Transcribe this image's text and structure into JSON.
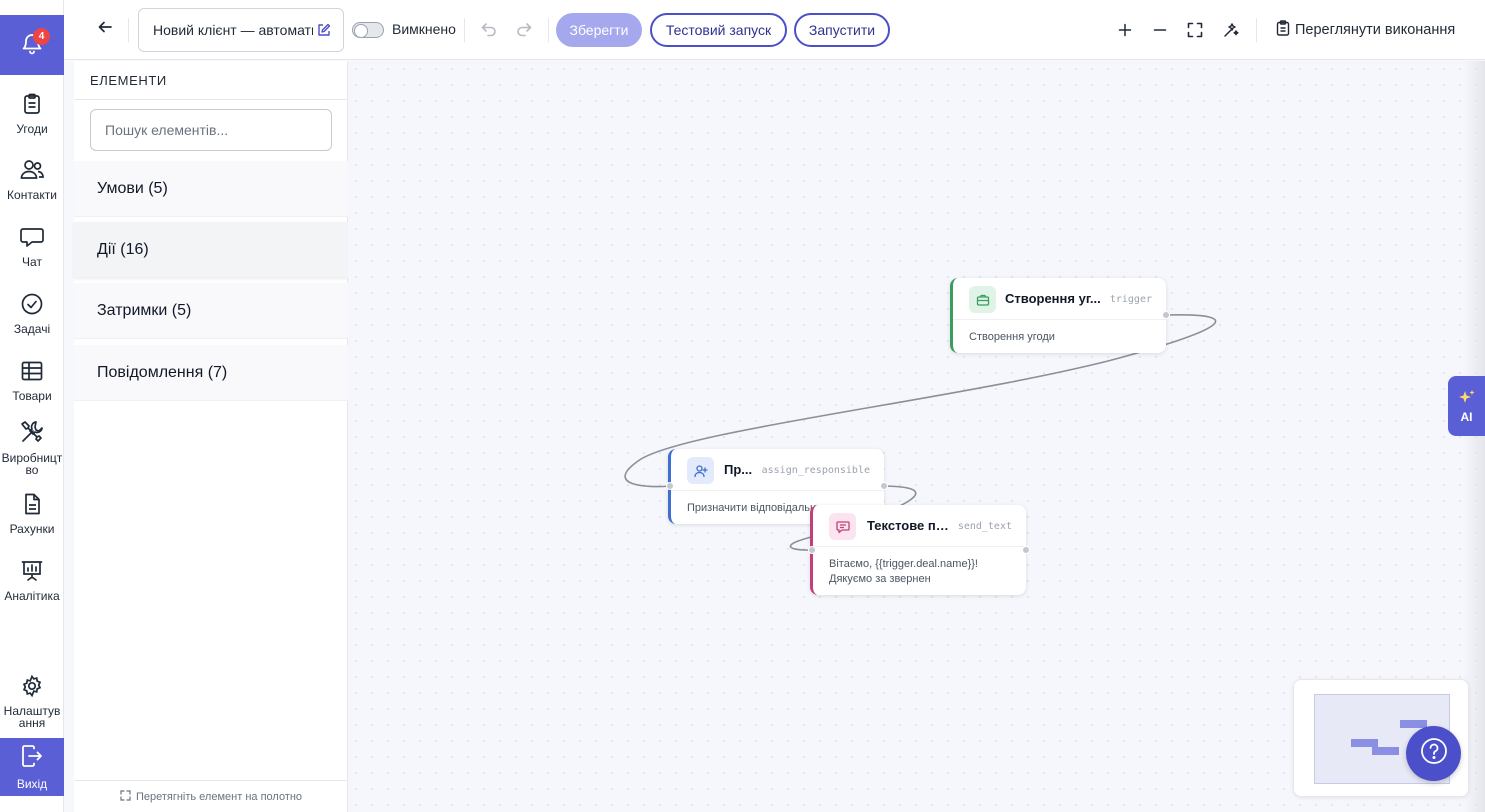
{
  "nav": {
    "notifications_count": "4",
    "items": [
      {
        "label": "Угоди"
      },
      {
        "label": "Контакти"
      },
      {
        "label": "Чат"
      },
      {
        "label": "Задачі"
      },
      {
        "label": "Товари"
      },
      {
        "label": "Виробництво"
      },
      {
        "label": "Рахунки"
      },
      {
        "label": "Аналітика"
      },
      {
        "label": "Налаштування"
      }
    ],
    "exit_label": "Вихід"
  },
  "toolbar": {
    "workflow_name": "Новий клієнт — автоматизація",
    "toggle_label": "Вимкнено",
    "save_label": "Зберегти",
    "test_run_label": "Тестовий запуск",
    "run_label": "Запустити",
    "view_executions_label": "Переглянути виконання"
  },
  "panel": {
    "title": "ЕЛЕМЕНТИ",
    "search_placeholder": "Пошук елементів...",
    "categories": [
      {
        "label": "Умови (5)"
      },
      {
        "label": "Дії (16)"
      },
      {
        "label": "Затримки (5)"
      },
      {
        "label": "Повідомлення (7)"
      }
    ],
    "footer_hint": "Перетягніть елемент на полотно"
  },
  "nodes": [
    {
      "title": "Створення уг...",
      "key": "trigger",
      "body": "Створення угоди",
      "accent": "#3a9d5d"
    },
    {
      "title": "Пр...",
      "key": "assign_responsible",
      "body": "Призначити відповідальн",
      "accent": "#3f6fd1"
    },
    {
      "title": "Текстове по...",
      "key": "send_text",
      "body": "Вітаємо, {{trigger.deal.name}}!",
      "body2": "Дякуємо за звернен",
      "accent": "#c2407a"
    }
  ],
  "ai_label": "AI",
  "colors": {
    "brand": "#5b5fd6",
    "button_outline": "#4b4fc9",
    "save_disabled": "#a5a8ec"
  }
}
